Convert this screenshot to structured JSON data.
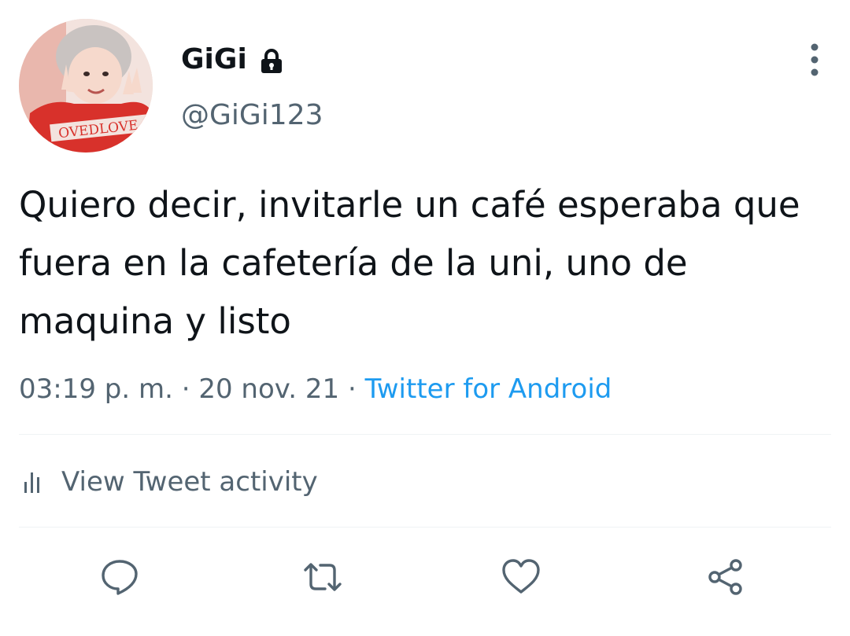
{
  "user": {
    "display_name": "GiGi",
    "handle": "@GiGi123",
    "avatar_shirt_text": "OVEDLOVE",
    "lock_icon": "lock-icon"
  },
  "tweet": {
    "text": "Quiero decir, invitarle un café esperaba que fuera en la cafetería de la uni, uno de maquina y listo",
    "time": "03:19 p. m.",
    "separator": " · ",
    "date": "20 nov. 21",
    "source": "Twitter for Android"
  },
  "activity": {
    "label": "View Tweet activity",
    "icon": "bar-chart-icon"
  },
  "actions": {
    "icons": [
      "reply-icon",
      "retweet-icon",
      "like-icon",
      "share-icon"
    ]
  },
  "colors": {
    "text_primary": "#0f1419",
    "text_secondary": "#536471",
    "link": "#1d9bf0",
    "divider": "#eff3f4"
  }
}
